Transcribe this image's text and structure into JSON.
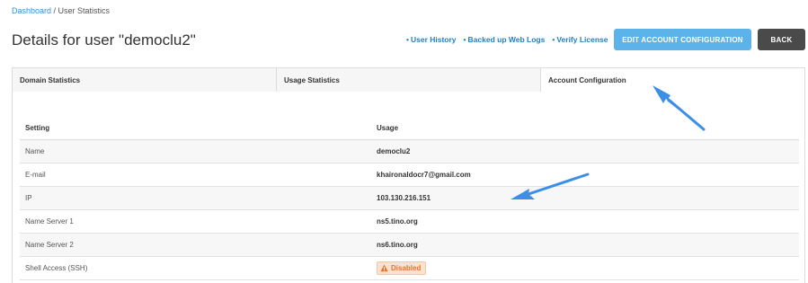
{
  "breadcrumb": {
    "home": "Dashboard",
    "separator": " / ",
    "current": "User Statistics"
  },
  "page": {
    "title": "Details for user \"democlu2\""
  },
  "links": [
    {
      "label": "User History"
    },
    {
      "label": "Backed up Web Logs"
    },
    {
      "label": "Verify License"
    }
  ],
  "buttons": {
    "edit": "EDIT ACCOUNT CONFIGURATION",
    "back": "BACK"
  },
  "tabs": [
    {
      "label": "Domain Statistics",
      "active": false
    },
    {
      "label": "Usage Statistics",
      "active": false
    },
    {
      "label": "Account Configuration",
      "active": true
    }
  ],
  "table": {
    "headers": [
      "Setting",
      "Usage"
    ],
    "rows": [
      {
        "setting": "Name",
        "usage": "democlu2"
      },
      {
        "setting": "E-mail",
        "usage": "khaironaldocr7@gmail.com"
      },
      {
        "setting": "IP",
        "usage": "103.130.216.151"
      },
      {
        "setting": "Name Server 1",
        "usage": "ns5.tino.org"
      },
      {
        "setting": "Name Server 2",
        "usage": "ns6.tino.org"
      },
      {
        "setting": "Shell Access (SSH)",
        "usage": "Disabled"
      }
    ]
  },
  "colors": {
    "accent": "#5cb3ea",
    "link": "#1f7ec4",
    "back_button": "#4a4a4a",
    "warning": "#e8742e",
    "annotation_arrow": "#3b8fe6"
  },
  "icons": {
    "bullet": "dot-icon",
    "warning": "warning-icon",
    "annotation": "arrow-icon"
  }
}
